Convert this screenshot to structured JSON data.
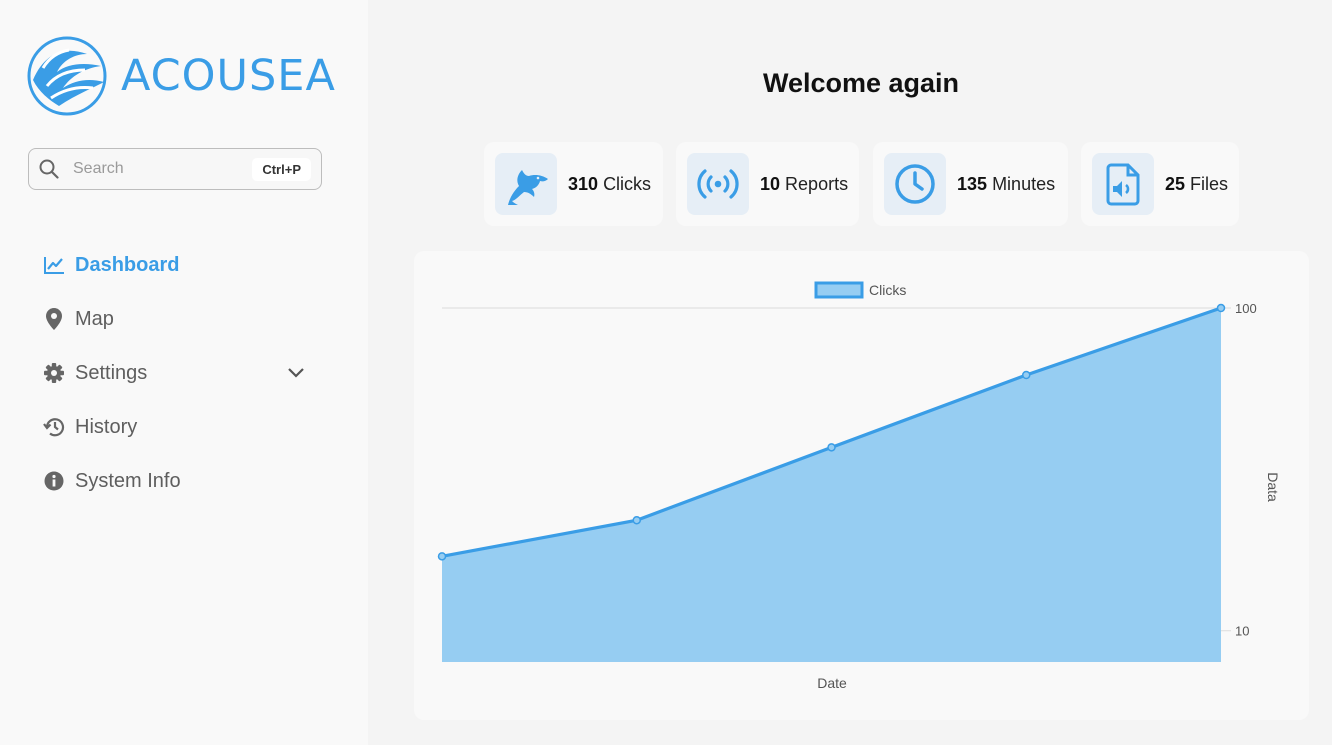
{
  "app": {
    "name": "ACOUSEA"
  },
  "search": {
    "placeholder": "Search",
    "shortcut": "Ctrl+P"
  },
  "nav": {
    "items": [
      {
        "label": "Dashboard",
        "icon": "chart-line-icon",
        "active": true
      },
      {
        "label": "Map",
        "icon": "map-pin-icon"
      },
      {
        "label": "Settings",
        "icon": "gear-icon",
        "expandable": true
      },
      {
        "label": "History",
        "icon": "history-icon"
      },
      {
        "label": "System Info",
        "icon": "info-icon"
      }
    ]
  },
  "main": {
    "title": "Welcome again"
  },
  "stats": [
    {
      "value": "310",
      "label": "Clicks",
      "icon": "dolphin-icon"
    },
    {
      "value": "10",
      "label": "Reports",
      "icon": "broadcast-icon"
    },
    {
      "value": "135",
      "label": "Minutes",
      "icon": "clock-icon"
    },
    {
      "value": "25",
      "label": "Files",
      "icon": "audio-file-icon"
    }
  ],
  "colors": {
    "accent": "#3a9de6",
    "fill": "#96cdf2",
    "text": "#333333"
  },
  "chart_data": {
    "type": "area",
    "legend": [
      "Clicks"
    ],
    "legend_position": "top",
    "xlabel": "Date",
    "ylabel": "Data",
    "y_scale": "log",
    "y_axis_position": "right",
    "y_ticks": [
      10,
      100
    ],
    "ylim": [
      8,
      100
    ],
    "series": [
      {
        "name": "Clicks",
        "values": [
          17,
          22,
          37,
          62,
          100
        ]
      }
    ]
  }
}
